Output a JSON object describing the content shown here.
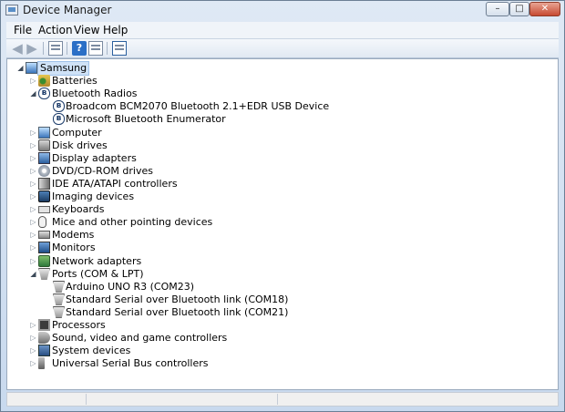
{
  "window": {
    "title": "Device Manager",
    "controls": {
      "minimize": "–",
      "maximize": "□",
      "close": "✕"
    }
  },
  "menu": [
    {
      "label": "File"
    },
    {
      "label": "Action"
    },
    {
      "label": "View"
    },
    {
      "label": "Help"
    }
  ],
  "toolbar": {
    "back_icon": "back-arrow-icon",
    "forward_icon": "forward-arrow-icon",
    "help_glyph": "?"
  },
  "tree": {
    "root": {
      "label": "Samsung",
      "expanded": true
    },
    "items": [
      {
        "label": "Batteries",
        "icon": "battery-icon",
        "expanded": false
      },
      {
        "label": "Bluetooth Radios",
        "icon": "bluetooth-icon",
        "expanded": true,
        "children": [
          {
            "label": "Broadcom BCM2070 Bluetooth 2.1+EDR USB Device",
            "icon": "bluetooth-icon"
          },
          {
            "label": "Microsoft Bluetooth Enumerator",
            "icon": "bluetooth-icon"
          }
        ]
      },
      {
        "label": "Computer",
        "icon": "computer-icon",
        "expanded": false
      },
      {
        "label": "Disk drives",
        "icon": "disk-icon",
        "expanded": false
      },
      {
        "label": "Display adapters",
        "icon": "display-icon",
        "expanded": false
      },
      {
        "label": "DVD/CD-ROM drives",
        "icon": "dvd-icon",
        "expanded": false
      },
      {
        "label": "IDE ATA/ATAPI controllers",
        "icon": "ide-icon",
        "expanded": false
      },
      {
        "label": "Imaging devices",
        "icon": "imaging-icon",
        "expanded": false
      },
      {
        "label": "Keyboards",
        "icon": "keyboard-icon",
        "expanded": false
      },
      {
        "label": "Mice and other pointing devices",
        "icon": "mouse-icon",
        "expanded": false
      },
      {
        "label": "Modems",
        "icon": "modem-icon",
        "expanded": false
      },
      {
        "label": "Monitors",
        "icon": "monitor-icon",
        "expanded": false
      },
      {
        "label": "Network adapters",
        "icon": "network-icon",
        "expanded": false
      },
      {
        "label": "Ports (COM & LPT)",
        "icon": "port-icon",
        "expanded": true,
        "children": [
          {
            "label": "Arduino UNO R3 (COM23)",
            "icon": "port-icon"
          },
          {
            "label": "Standard Serial over Bluetooth link (COM18)",
            "icon": "port-icon"
          },
          {
            "label": "Standard Serial over Bluetooth link (COM21)",
            "icon": "port-icon"
          }
        ]
      },
      {
        "label": "Processors",
        "icon": "processor-icon",
        "expanded": false
      },
      {
        "label": "Sound, video and game controllers",
        "icon": "sound-icon",
        "expanded": false
      },
      {
        "label": "System devices",
        "icon": "system-devices-icon",
        "expanded": false
      },
      {
        "label": "Universal Serial Bus controllers",
        "icon": "usb-icon",
        "expanded": false
      }
    ]
  }
}
